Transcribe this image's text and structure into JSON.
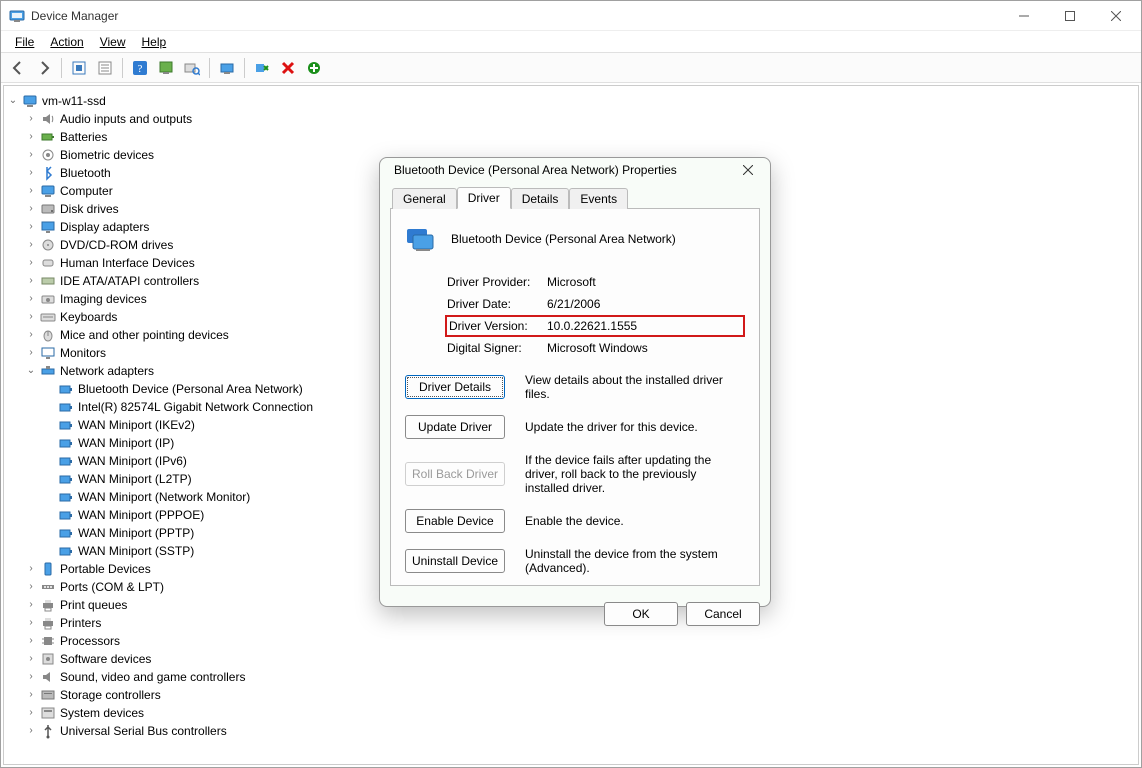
{
  "titlebar": {
    "title": "Device Manager"
  },
  "menu": {
    "items": [
      "File",
      "Action",
      "View",
      "Help"
    ]
  },
  "toolbar": {
    "buttons": [
      {
        "name": "back-icon"
      },
      {
        "name": "forward-icon"
      },
      {
        "sep": true
      },
      {
        "name": "show-hidden-icon"
      },
      {
        "name": "properties-icon"
      },
      {
        "sep": true
      },
      {
        "name": "help-icon"
      },
      {
        "name": "update-driver-icon"
      },
      {
        "name": "scan-hardware-icon"
      },
      {
        "sep": true
      },
      {
        "name": "disable-icon"
      },
      {
        "sep": true
      },
      {
        "name": "uninstall-device-icon"
      },
      {
        "name": "remove-icon"
      },
      {
        "name": "add-icon"
      }
    ]
  },
  "tree": {
    "root": "vm-w11-ssd",
    "nodes": [
      {
        "label": "Audio inputs and outputs",
        "icon": "audio-icon",
        "expandable": true
      },
      {
        "label": "Batteries",
        "icon": "battery-icon",
        "expandable": true
      },
      {
        "label": "Biometric devices",
        "icon": "biometric-icon",
        "expandable": true
      },
      {
        "label": "Bluetooth",
        "icon": "bluetooth-icon",
        "expandable": true
      },
      {
        "label": "Computer",
        "icon": "computer-icon",
        "expandable": true
      },
      {
        "label": "Disk drives",
        "icon": "disk-icon",
        "expandable": true
      },
      {
        "label": "Display adapters",
        "icon": "display-icon",
        "expandable": true
      },
      {
        "label": "DVD/CD-ROM drives",
        "icon": "optical-icon",
        "expandable": true
      },
      {
        "label": "Human Interface Devices",
        "icon": "hid-icon",
        "expandable": true
      },
      {
        "label": "IDE ATA/ATAPI controllers",
        "icon": "ide-icon",
        "expandable": true
      },
      {
        "label": "Imaging devices",
        "icon": "imaging-icon",
        "expandable": true
      },
      {
        "label": "Keyboards",
        "icon": "keyboard-icon",
        "expandable": true
      },
      {
        "label": "Mice and other pointing devices",
        "icon": "mouse-icon",
        "expandable": true
      },
      {
        "label": "Monitors",
        "icon": "monitor-icon",
        "expandable": true
      },
      {
        "label": "Network adapters",
        "icon": "network-icon",
        "expandable": true,
        "expanded": true,
        "children": [
          {
            "label": "Bluetooth Device (Personal Area Network)",
            "icon": "nic-icon"
          },
          {
            "label": "Intel(R) 82574L Gigabit Network Connection",
            "icon": "nic-icon"
          },
          {
            "label": "WAN Miniport (IKEv2)",
            "icon": "nic-icon"
          },
          {
            "label": "WAN Miniport (IP)",
            "icon": "nic-icon"
          },
          {
            "label": "WAN Miniport (IPv6)",
            "icon": "nic-icon"
          },
          {
            "label": "WAN Miniport (L2TP)",
            "icon": "nic-icon"
          },
          {
            "label": "WAN Miniport (Network Monitor)",
            "icon": "nic-icon"
          },
          {
            "label": "WAN Miniport (PPPOE)",
            "icon": "nic-icon"
          },
          {
            "label": "WAN Miniport (PPTP)",
            "icon": "nic-icon"
          },
          {
            "label": "WAN Miniport (SSTP)",
            "icon": "nic-icon"
          }
        ]
      },
      {
        "label": "Portable Devices",
        "icon": "portable-icon",
        "expandable": true
      },
      {
        "label": "Ports (COM & LPT)",
        "icon": "ports-icon",
        "expandable": true
      },
      {
        "label": "Print queues",
        "icon": "printqueue-icon",
        "expandable": true
      },
      {
        "label": "Printers",
        "icon": "printer-icon",
        "expandable": true
      },
      {
        "label": "Processors",
        "icon": "cpu-icon",
        "expandable": true
      },
      {
        "label": "Software devices",
        "icon": "software-icon",
        "expandable": true
      },
      {
        "label": "Sound, video and game controllers",
        "icon": "sound-icon",
        "expandable": true
      },
      {
        "label": "Storage controllers",
        "icon": "storage-icon",
        "expandable": true
      },
      {
        "label": "System devices",
        "icon": "system-icon",
        "expandable": true
      },
      {
        "label": "Universal Serial Bus controllers",
        "icon": "usb-icon",
        "expandable": true
      }
    ]
  },
  "dialog": {
    "title": "Bluetooth Device (Personal Area Network) Properties",
    "tabs": [
      "General",
      "Driver",
      "Details",
      "Events"
    ],
    "active_tab": "Driver",
    "device_name": "Bluetooth Device (Personal Area Network)",
    "fields": {
      "provider_label": "Driver Provider:",
      "provider_value": "Microsoft",
      "date_label": "Driver Date:",
      "date_value": "6/21/2006",
      "version_label": "Driver Version:",
      "version_value": "10.0.22621.1555",
      "signer_label": "Digital Signer:",
      "signer_value": "Microsoft Windows"
    },
    "actions": [
      {
        "label": "Driver Details",
        "desc": "View details about the installed driver files.",
        "focused": true
      },
      {
        "label": "Update Driver",
        "desc": "Update the driver for this device."
      },
      {
        "label": "Roll Back Driver",
        "desc": "If the device fails after updating the driver, roll back to the previously installed driver.",
        "disabled": true
      },
      {
        "label": "Enable Device",
        "desc": "Enable the device."
      },
      {
        "label": "Uninstall Device",
        "desc": "Uninstall the device from the system (Advanced)."
      }
    ],
    "ok": "OK",
    "cancel": "Cancel"
  }
}
